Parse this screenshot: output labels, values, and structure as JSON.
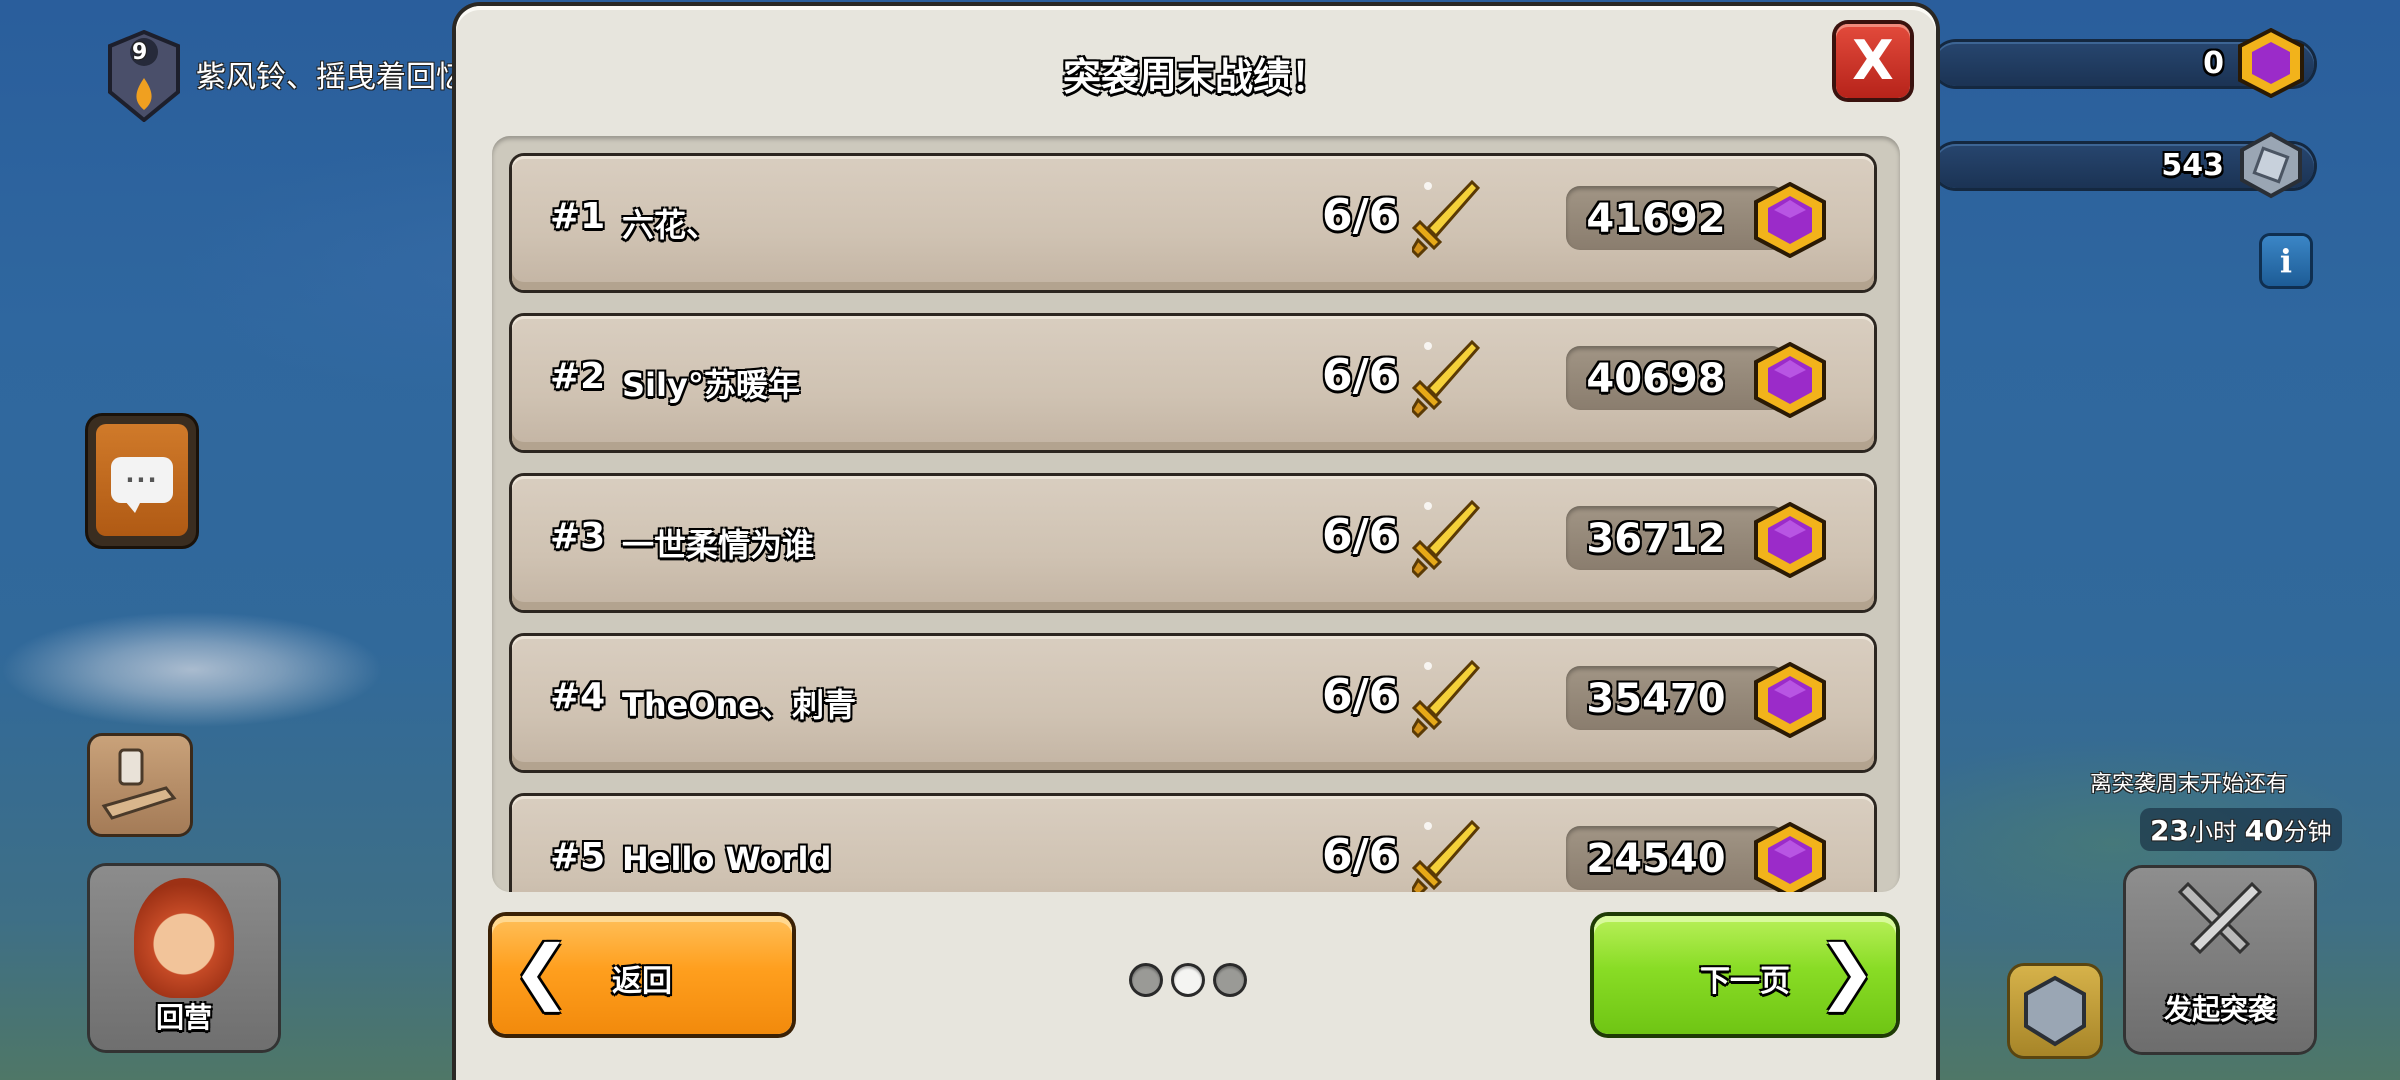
{
  "hud": {
    "clan_level": "9",
    "clan_name": "紫风铃、摇曳着回忆",
    "resource_gems": "0",
    "resource_trophies": "543",
    "info_label": "i",
    "countdown_label": "离突袭周末开始还有",
    "countdown_hours": "23",
    "countdown_hours_unit": "小时",
    "countdown_minutes": "40",
    "countdown_minutes_unit": "分钟",
    "raid_button_label": "发起突袭",
    "home_button_label": "回营",
    "chat_icon": "chat-bubble-icon",
    "war_icon": "clan-war-icon"
  },
  "modal": {
    "title": "突袭周末战绩！",
    "close_label": "X",
    "rows": [
      {
        "rank": "#1",
        "name": "六花、",
        "attacks": "6/6",
        "score": "41692"
      },
      {
        "rank": "#2",
        "name": "Sily°苏暖年",
        "attacks": "6/6",
        "score": "40698"
      },
      {
        "rank": "#3",
        "name": "一世柔情为谁",
        "attacks": "6/6",
        "score": "36712"
      },
      {
        "rank": "#4",
        "name": "TheOne、刺青",
        "attacks": "6/6",
        "score": "35470"
      },
      {
        "rank": "#5",
        "name": "Hello World",
        "attacks": "6/6",
        "score": "24540"
      }
    ],
    "back_label": "返回",
    "next_label": "下一页",
    "page_count": 3,
    "active_page": 2,
    "colors": {
      "back": "#ff9f1e",
      "next": "#89dc25",
      "medal": "#9b2bc9",
      "sword": "#f0c020"
    }
  }
}
